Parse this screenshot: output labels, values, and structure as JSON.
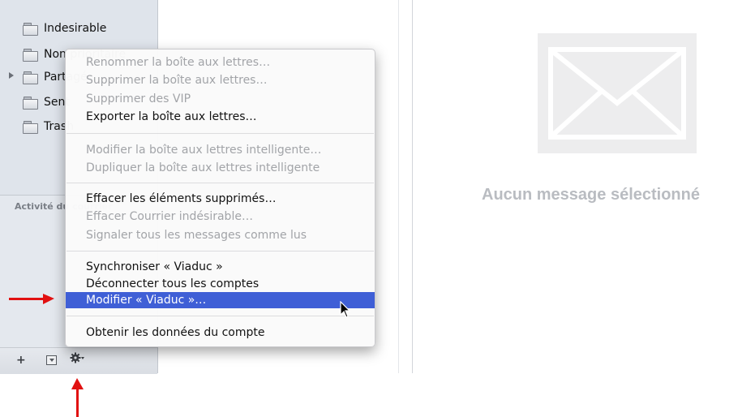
{
  "sidebar": {
    "mailboxes": [
      {
        "label": "Indesirable"
      },
      {
        "label": "Non prioritaire"
      },
      {
        "label": "Partagé"
      },
      {
        "label": "Sent"
      },
      {
        "label": "Trash"
      }
    ],
    "activity_title": "Activité du courrier",
    "bottom_bar": {
      "add_label": "+"
    }
  },
  "viewer": {
    "empty_state_label": "Aucun message sélectionné"
  },
  "context_menu": {
    "items": [
      {
        "label": "Renommer la boîte aux lettres…",
        "enabled": false
      },
      {
        "label": "Supprimer la boîte aux lettres…",
        "enabled": false
      },
      {
        "label": "Supprimer des VIP",
        "enabled": false
      },
      {
        "label": "Exporter la boîte aux lettres…",
        "enabled": true
      },
      {
        "label": "Modifier la boîte aux lettres intelligente…",
        "enabled": false
      },
      {
        "label": "Dupliquer la boîte aux lettres intelligente",
        "enabled": false
      },
      {
        "label": "Effacer les éléments supprimés…",
        "enabled": true
      },
      {
        "label": "Effacer Courrier indésirable…",
        "enabled": false
      },
      {
        "label": "Signaler tous les messages comme lus",
        "enabled": false
      },
      {
        "label": "Synchroniser « Viaduc »",
        "enabled": true
      },
      {
        "label": "Déconnecter tous les comptes",
        "enabled": true
      },
      {
        "label": "Modifier « Viaduc »…",
        "enabled": true,
        "selected": true
      },
      {
        "label": "Obtenir les données du compte",
        "enabled": true
      }
    ]
  },
  "colors": {
    "selection": "#3f5fd6",
    "annotation_arrow": "#e11111",
    "sidebar_bg": "#dde2ea"
  }
}
